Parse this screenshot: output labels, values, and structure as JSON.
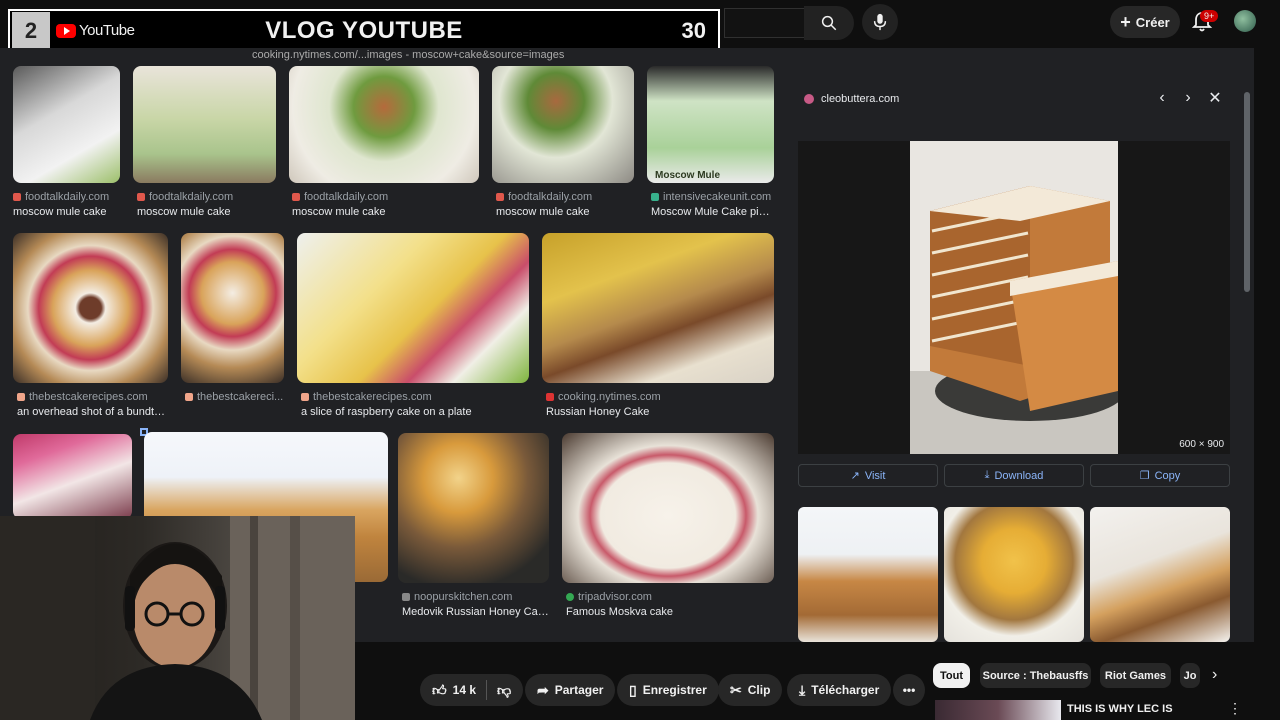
{
  "banner": {
    "number": "2",
    "logo_text": "YouTube",
    "title": "VLOG YOUTUBE",
    "count": "30"
  },
  "youtube_header": {
    "create_label": "Créer",
    "notification_badge": "9+"
  },
  "browser": {
    "url": "cooking.nytimes.com/...images - moscow+cake&source=images"
  },
  "grid": {
    "row1": [
      {
        "source": "foodtalkdaily.com",
        "caption": "moscow mule cake"
      },
      {
        "source": "foodtalkdaily.com",
        "caption": "moscow mule cake"
      },
      {
        "source": "foodtalkdaily.com",
        "caption": "moscow mule cake"
      },
      {
        "source": "foodtalkdaily.com",
        "caption": "moscow mule cake"
      },
      {
        "source": "intensivecakeunit.com",
        "caption": "Moscow Mule Cake pint..."
      }
    ],
    "row2": [
      {
        "source": "thebestcakerecipes.com",
        "caption": "an overhead shot of a bundt c..."
      },
      {
        "source": "thebestcakereci...",
        "caption": ""
      },
      {
        "source": "thebestcakerecipes.com",
        "caption": "a slice of raspberry cake on a plate"
      },
      {
        "source": "cooking.nytimes.com",
        "caption": "Russian Honey Cake"
      }
    ],
    "row3": [
      {
        "source": "noopurskitchen.com",
        "caption": "Medovik Russian Honey Cak..."
      },
      {
        "source": "tripadvisor.com",
        "caption": "Famous Moskva cake"
      }
    ],
    "thumb_label": "Moscow Mule"
  },
  "panel": {
    "source": "cleobuttera.com",
    "dimensions": "600 × 900",
    "visit_label": "Visit",
    "download_label": "Download",
    "copy_label": "Copy"
  },
  "actions": {
    "likes": "14 k",
    "share": "Partager",
    "save": "Enregistrer",
    "clip": "Clip",
    "download": "Télécharger"
  },
  "chips": [
    "Tout",
    "Source : Thebausffs",
    "Riot Games",
    "Jo"
  ],
  "recommendation": {
    "title": "THIS IS WHY LEC IS"
  },
  "colors": {
    "accent": "#8ab4f8",
    "yt_red": "#ff0000"
  }
}
